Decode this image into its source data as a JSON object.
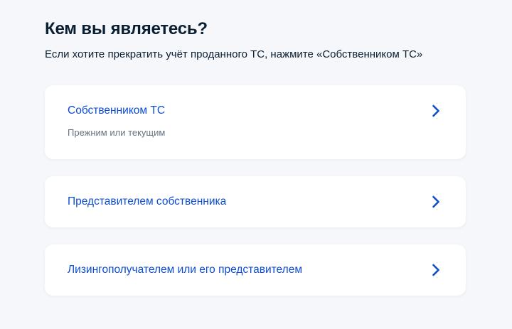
{
  "header": {
    "title": "Кем вы являетесь?",
    "subtitle": "Если хотите прекратить учёт проданного ТС, нажмите «Собственником ТС»"
  },
  "options": [
    {
      "label": "Собственником ТС",
      "hint": "Прежним или текущим",
      "icon": "chevron-right-icon"
    },
    {
      "label": "Представителем собственника",
      "icon": "chevron-right-icon"
    },
    {
      "label": "Лизингополучателем или его представителем",
      "icon": "chevron-right-icon"
    }
  ],
  "colors": {
    "background": "#f5f7fa",
    "card": "#ffffff",
    "link": "#0d4cd3",
    "text": "#0b1f33",
    "hint": "#66727f"
  }
}
